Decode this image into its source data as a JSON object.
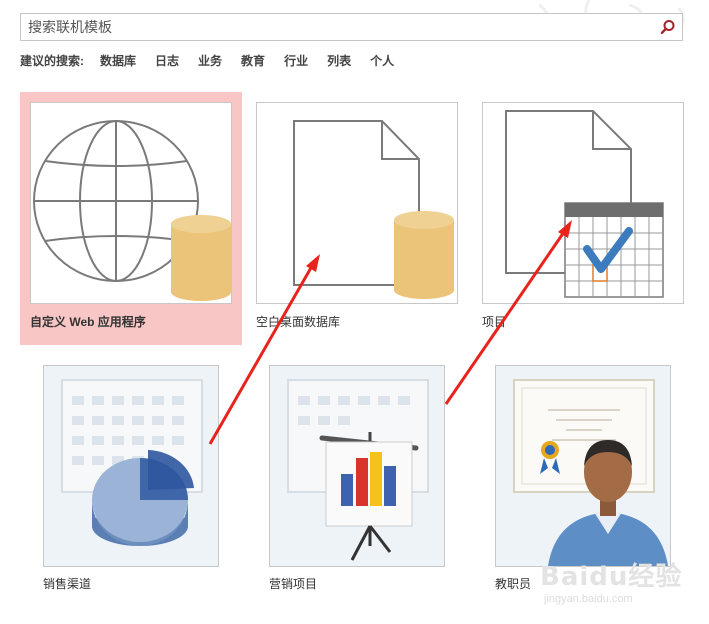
{
  "search": {
    "placeholder": "搜索联机模板",
    "icon": "search-icon"
  },
  "suggested": {
    "lead": "建议的搜索:",
    "links": [
      "数据库",
      "日志",
      "业务",
      "教育",
      "行业",
      "列表",
      "个人"
    ]
  },
  "templates_row1": [
    {
      "label": "自定义 Web 应用程序",
      "icon": "globe-database-icon",
      "selected": true
    },
    {
      "label": "空白桌面数据库",
      "icon": "blank-document-database-icon",
      "selected": false
    },
    {
      "label": "项目",
      "icon": "document-calendar-check-icon",
      "selected": false
    }
  ],
  "templates_row2": [
    {
      "label": "销售渠道",
      "icon": "pie-chart-calendar-icon"
    },
    {
      "label": "营销项目",
      "icon": "bar-chart-easel-icon"
    },
    {
      "label": "教职员",
      "icon": "staff-certificate-icon"
    }
  ],
  "watermark": {
    "main": "Baidu经验",
    "sub": "jingyan.baidu.com"
  },
  "colors": {
    "selected_bg": "#f9c6c6",
    "db_cylinder": "#ebc47a",
    "arrow_red": "#e8231c",
    "check_blue": "#3d7bbf"
  }
}
